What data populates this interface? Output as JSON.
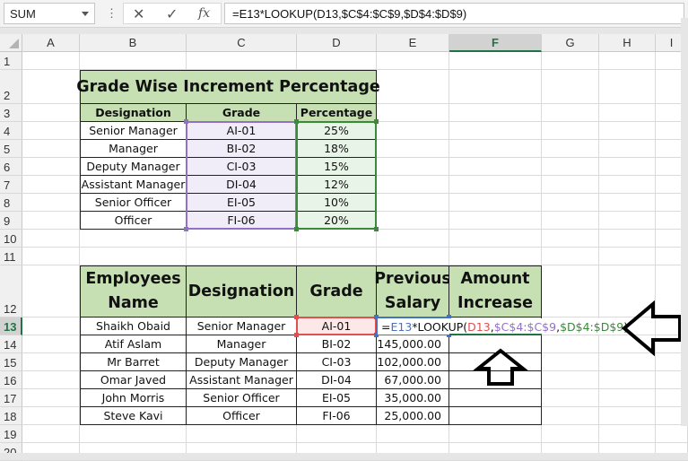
{
  "formula_bar": {
    "name_box": "SUM",
    "more_icon": "vertical-ellipsis",
    "cancel_icon": "✕",
    "enter_icon": "✓",
    "fx_label": "fx",
    "formula": "=E13*LOOKUP(D13,$C$4:$C$9,$D$4:$D$9)"
  },
  "columns": [
    "A",
    "B",
    "C",
    "D",
    "E",
    "F",
    "G",
    "H",
    "I"
  ],
  "selected_column": "F",
  "rows": [
    "1",
    "2",
    "3",
    "4",
    "5",
    "6",
    "7",
    "8",
    "9",
    "10",
    "11",
    "12",
    "13",
    "14",
    "15",
    "16",
    "17",
    "18",
    "19",
    "20"
  ],
  "selected_row": "13",
  "lookup_table": {
    "title": "Grade Wise Increment Percentage",
    "headers": [
      "Designation",
      "Grade",
      "Percentage"
    ],
    "rows": [
      [
        "Senior Manager",
        "AI-01",
        "25%"
      ],
      [
        "Manager",
        "BI-02",
        "18%"
      ],
      [
        "Deputy Manager",
        "CI-03",
        "15%"
      ],
      [
        "Assistant Manager",
        "DI-04",
        "12%"
      ],
      [
        "Senior Officer",
        "EI-05",
        "10%"
      ],
      [
        "Officer",
        "FI-06",
        "20%"
      ]
    ]
  },
  "employee_table": {
    "headers": [
      "Employees Name",
      "Designation",
      "Grade",
      "Previous Salary",
      "Amount Increase"
    ],
    "rows": [
      [
        "Shaikh Obaid",
        "Senior Manager",
        "AI-01",
        "",
        ""
      ],
      [
        "Atif Aslam",
        "Manager",
        "BI-02",
        "145,000.00",
        ""
      ],
      [
        "Mr Barret",
        "Deputy Manager",
        "CI-03",
        "102,000.00",
        ""
      ],
      [
        "Omar Javed",
        "Assistant Manager",
        "DI-04",
        "67,000.00",
        ""
      ],
      [
        "John Morris",
        "Senior Officer",
        "EI-05",
        "35,000.00",
        ""
      ],
      [
        "Steve Kavi",
        "Officer",
        "FI-06",
        "25,000.00",
        ""
      ]
    ]
  },
  "editing_formula": {
    "parts": [
      {
        "text": "=",
        "color": "#111111"
      },
      {
        "text": "E13",
        "color": "#4472c4"
      },
      {
        "text": "*LOOKUP(",
        "color": "#111111"
      },
      {
        "text": "D13",
        "color": "#e05050"
      },
      {
        "text": ",",
        "color": "#111111"
      },
      {
        "text": "$C$4:$C$9",
        "color": "#9370c8"
      },
      {
        "text": ",",
        "color": "#111111"
      },
      {
        "text": "$D$4:$D$9",
        "color": "#3a8a3a"
      },
      {
        "text": ")",
        "color": "#111111"
      }
    ]
  },
  "annotations": {
    "left_arrow": "pointing-left-arrow",
    "up_arrow": "pointing-up-arrow"
  }
}
